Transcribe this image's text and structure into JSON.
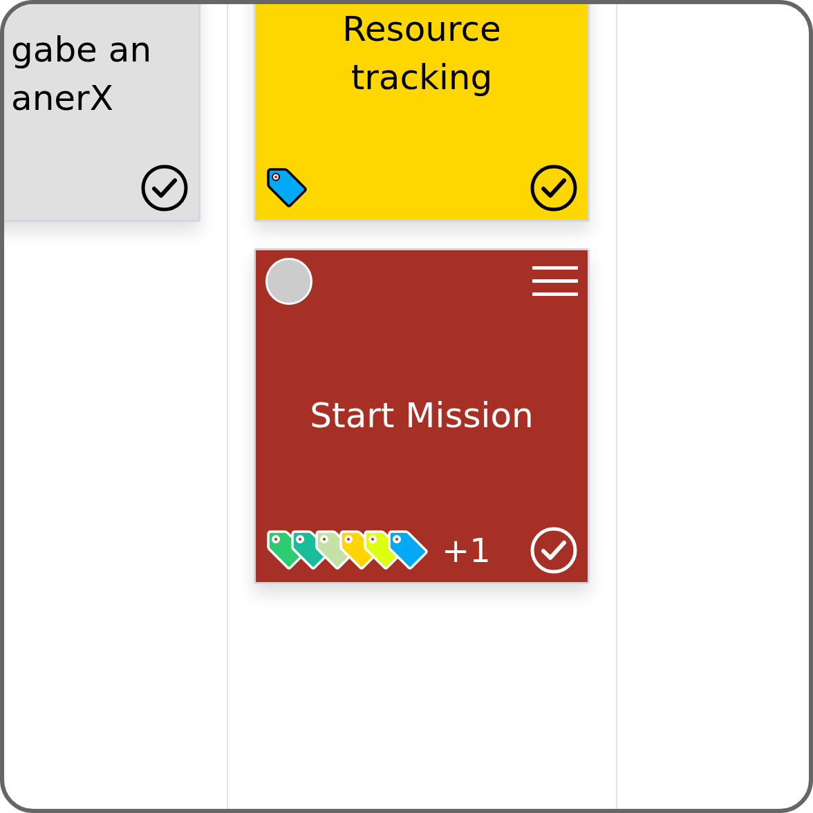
{
  "columns": [
    {
      "cards": [
        {
          "lines": [
            "gabe an",
            "anerX"
          ],
          "color": "#e0e0e0"
        }
      ]
    },
    {
      "cards": [
        {
          "lines": [
            "Resource",
            "tracking"
          ],
          "color": "#ffd700",
          "tags": [
            {
              "color": "#03a9f4"
            }
          ]
        },
        {
          "lines": [
            "Start Mission"
          ],
          "color": "#a63026",
          "controls": true,
          "tags": [
            {
              "color": "#2ecc71"
            },
            {
              "color": "#1abc9c"
            },
            {
              "color": "#c5e1a5"
            },
            {
              "color": "#ffd600"
            },
            {
              "color": "#ddff11"
            },
            {
              "color": "#03a9f4"
            }
          ],
          "more_tags": "+1"
        }
      ]
    }
  ]
}
